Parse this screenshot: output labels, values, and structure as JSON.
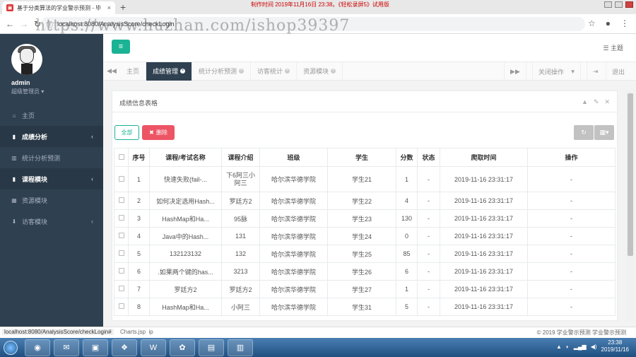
{
  "browser": {
    "tab_title": "基于分类算法的学业警示预测 - 毕",
    "tab_close": "×",
    "new_tab": "+",
    "overlay_text": "制作时间 2019年11月16日 23:38。《轻松录屏5》试用版",
    "url": "localhost:8080/AnalysisScore/checkLogin",
    "watermark": "https://www.huzhan.com/ishop39397"
  },
  "sidebar": {
    "user_name": "admin",
    "user_role": "超级管理员",
    "items": [
      {
        "label": "主页",
        "icon": "home-icon"
      },
      {
        "label": "成绩分析",
        "icon": "book-icon",
        "arrow": "‹"
      },
      {
        "label": "统计分析预测",
        "icon": "bar-chart-icon"
      },
      {
        "label": "课程模块",
        "icon": "book-icon",
        "arrow": "‹"
      },
      {
        "label": "资源模块",
        "icon": "grid-icon"
      },
      {
        "label": "访客模块",
        "icon": "download-icon",
        "arrow": "‹"
      }
    ]
  },
  "topbar": {
    "theme_label": "主题"
  },
  "tabs": {
    "items": [
      "主页",
      "成绩管理",
      "统计分析预测",
      "访客统计",
      "资源模块"
    ],
    "close_ops": "关闭操作",
    "logout": "退出"
  },
  "panel": {
    "title": "成绩信息表格",
    "btn_all": "全部",
    "btn_delete": "删除",
    "columns": [
      "序号",
      "课程/考试名称",
      "课程介绍",
      "班级",
      "学生",
      "分数",
      "状态",
      "爬取时间",
      "操作"
    ],
    "rows": [
      {
        "no": "1",
        "name": "快速失败(fail-...",
        "intro": "下6阿三小阿三",
        "cls": "哈尔滨华德学院",
        "student": "学生21",
        "score": "1",
        "status": "-",
        "time": "2019-11-16 23:31:17",
        "op": "-"
      },
      {
        "no": "2",
        "name": "如何决定选用Hash...",
        "intro": "罗廷方2",
        "cls": "哈尔滨华德学院",
        "student": "学生22",
        "score": "4",
        "status": "-",
        "time": "2019-11-16 23:31:17",
        "op": "-"
      },
      {
        "no": "3",
        "name": "HashMap和Ha...",
        "intro": "95脉",
        "cls": "哈尔滨华德学院",
        "student": "学生23",
        "score": "130",
        "status": "-",
        "time": "2019-11-16 23:31:17",
        "op": "-"
      },
      {
        "no": "4",
        "name": "Java中的Hash...",
        "intro": "131",
        "cls": "哈尔滨华德学院",
        "student": "学生24",
        "score": "0",
        "status": "-",
        "time": "2019-11-16 23:31:17",
        "op": "-"
      },
      {
        "no": "5",
        "name": "132123132",
        "intro": "132",
        "cls": "哈尔滨华德学院",
        "student": "学生25",
        "score": "85",
        "status": "-",
        "time": "2019-11-16 23:31:17",
        "op": "-"
      },
      {
        "no": "6",
        "name": ".如果两个键的has...",
        "intro": "3213",
        "cls": "哈尔滨华德学院",
        "student": "学生26",
        "score": "6",
        "status": "-",
        "time": "2019-11-16 23:31:17",
        "op": "-"
      },
      {
        "no": "7",
        "name": "罗廷方2",
        "intro": "罗廷方2",
        "cls": "哈尔滨华德学院",
        "student": "学生27",
        "score": "1",
        "status": "-",
        "time": "2019-11-16 23:31:17",
        "op": "-"
      },
      {
        "no": "8",
        "name": "HashMap和Ha...",
        "intro": "小阿三",
        "cls": "哈尔滨华德学院",
        "student": "学生31",
        "score": "5",
        "status": "-",
        "time": "2019-11-16 23:31:17",
        "op": "-"
      }
    ]
  },
  "status": {
    "url": "localhost:8080/AnalysisScore/checkLogin#",
    "link": "Charts.jsp",
    "link2": "ip",
    "copyright": "© 2019 学业警示预测 学业警示预测"
  },
  "taskbar": {
    "time": "23:38",
    "date": "2019/11/16"
  }
}
